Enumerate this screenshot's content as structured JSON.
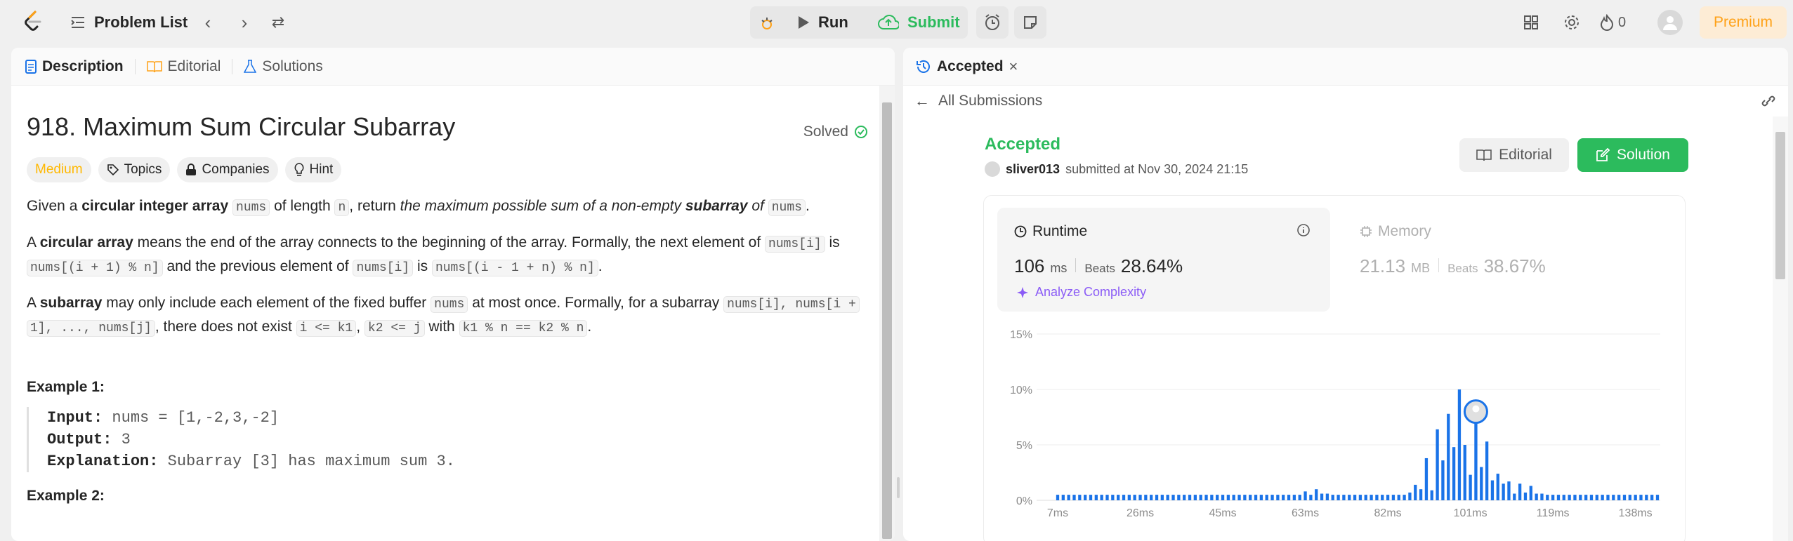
{
  "topbar": {
    "problem_list": "Problem List",
    "run": "Run",
    "submit": "Submit",
    "streak_count": "0",
    "premium": "Premium"
  },
  "left": {
    "tabs": [
      "Description",
      "Editorial",
      "Solutions"
    ],
    "title": "918. Maximum Sum Circular Subarray",
    "solved": "Solved",
    "tags": [
      "Medium",
      "Topics",
      "Companies",
      "Hint"
    ],
    "p1": {
      "a": "Given a ",
      "b": "circular integer array",
      "c": "nums",
      "d": " of length ",
      "e": "n",
      ", return ": "",
      "f": ", return ",
      "g": "the maximum possible sum of a non-empty ",
      "h": "subarray",
      "i": " of ",
      "j": "nums",
      "k": "."
    },
    "p2": {
      "a": "A ",
      "b": "circular array",
      "c": " means the end of the array connects to the beginning of the array. Formally, the next element of ",
      "d": "nums[i]",
      "e": " is",
      "f": "nums[(i + 1) % n]",
      "g": " and the previous element of ",
      "h": "nums[i]",
      "i": " is ",
      "j": "nums[(i - 1 + n) % n]",
      "k": "."
    },
    "p3": {
      "a": "A ",
      "b": "subarray",
      "c": " may only include each element of the fixed buffer ",
      "d": "nums",
      "e": " at most once. Formally, for a subarray ",
      "f": "nums[i], nums[i +",
      "g": "1], ..., nums[j]",
      "h": ", there does not exist ",
      "i": "i <= k1",
      "j": ", ",
      "k": "k2 <= j",
      "l": " with ",
      "m": "k1 % n == k2 % n",
      "n": "."
    },
    "example1": {
      "heading": "Example 1:",
      "input_label": "Input:",
      "input": " nums = [1,-2,3,-2]",
      "output_label": "Output:",
      "output": " 3",
      "expl_label": "Explanation:",
      "expl": " Subarray [3] has maximum sum 3."
    },
    "example2_heading": "Example 2:"
  },
  "right": {
    "tab": "Accepted",
    "back": "All Submissions",
    "status": "Accepted",
    "user": "sliver013",
    "submitted": "submitted at Nov 30, 2024 21:15",
    "editorial": "Editorial",
    "solution": "Solution",
    "runtime": {
      "label": "Runtime",
      "value": "106",
      "unit": "ms",
      "beats": "Beats",
      "pct": "28.64%",
      "analyze": "Analyze Complexity"
    },
    "memory": {
      "label": "Memory",
      "value": "21.13",
      "unit": "MB",
      "beats": "Beats",
      "pct": "38.67%"
    }
  },
  "colors": {
    "accent": "#2cbb5d",
    "orange": "#ffa116",
    "bar": "#1a73e8",
    "medium": "#ffb800"
  },
  "chart_data": {
    "type": "bar",
    "y_ticks": [
      "15%",
      "10%",
      "5%",
      "0%"
    ],
    "x_ticks": [
      "7ms",
      "26ms",
      "45ms",
      "63ms",
      "82ms",
      "101ms",
      "119ms",
      "138ms"
    ],
    "ylim": [
      0,
      15
    ],
    "values": [
      0.5,
      0.5,
      0.5,
      0.5,
      0.5,
      0.5,
      0.5,
      0.5,
      0.5,
      0.5,
      0.5,
      0.5,
      0.5,
      0.5,
      0.5,
      0.5,
      0.5,
      0.5,
      0.5,
      0.5,
      0.5,
      0.5,
      0.5,
      0.5,
      0.5,
      0.5,
      0.5,
      0.5,
      0.5,
      0.5,
      0.5,
      0.5,
      0.5,
      0.5,
      0.5,
      0.5,
      0.5,
      0.5,
      0.5,
      0.5,
      0.5,
      0.5,
      0.5,
      0.5,
      0.5,
      0.8,
      0.5,
      1.0,
      0.6,
      0.6,
      0.5,
      0.5,
      0.5,
      0.5,
      0.5,
      0.5,
      0.5,
      0.5,
      0.5,
      0.5,
      0.5,
      0.5,
      0.5,
      0.5,
      0.7,
      1.4,
      1.0,
      3.8,
      0.9,
      6.4,
      3.6,
      7.8,
      4.8,
      10.0,
      5.0,
      2.3,
      8.0,
      3.0,
      5.3,
      1.8,
      2.4,
      1.5,
      1.7,
      0.6,
      1.5,
      0.7,
      1.3,
      0.6,
      0.6,
      0.5,
      0.5,
      0.5,
      0.5,
      0.5,
      0.5,
      0.5,
      0.5,
      0.5,
      0.5,
      0.5,
      0.5,
      0.5,
      0.5,
      0.5,
      0.5,
      0.5,
      0.5,
      0.5,
      0.5,
      0.5
    ],
    "grid": true,
    "highlight_index": 76
  }
}
